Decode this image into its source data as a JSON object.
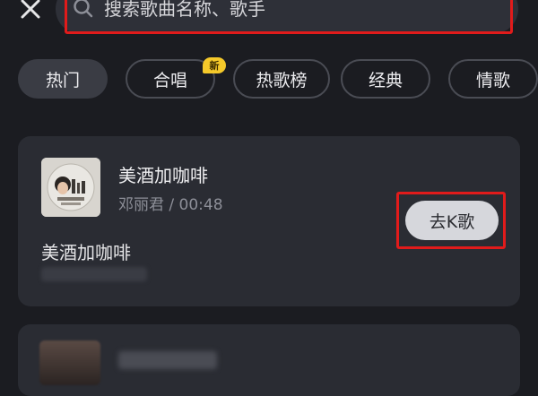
{
  "header": {
    "close_icon": "close-icon",
    "search": {
      "icon": "search-icon",
      "placeholder": "搜索歌曲名称、歌手"
    }
  },
  "tabs": [
    {
      "label": "热门",
      "active": true
    },
    {
      "label": "合唱",
      "active": false,
      "badge": "新"
    },
    {
      "label": "热歌榜",
      "active": false
    },
    {
      "label": "经典",
      "active": false
    },
    {
      "label": "情歌",
      "active": false
    }
  ],
  "songs": [
    {
      "title": "美酒加咖啡",
      "meta": "邓丽君 / 00:48",
      "lyric": "美酒加咖啡",
      "action_label": "去K歌"
    }
  ],
  "colors": {
    "background": "#1b1c21",
    "card": "#2a2c33",
    "highlight": "#e11b1b",
    "badge": "#f5c92a",
    "button": "#d6d7dc"
  }
}
